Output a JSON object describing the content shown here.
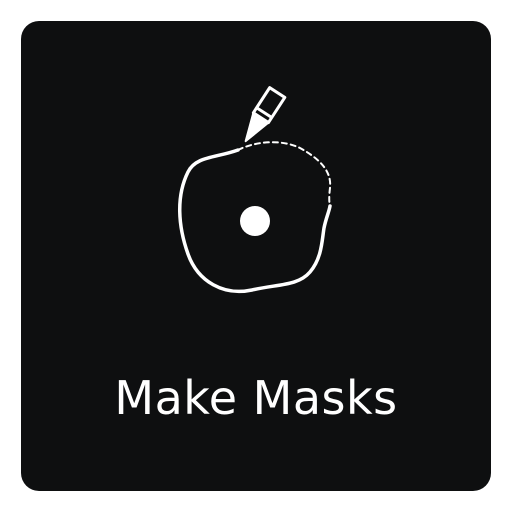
{
  "tile": {
    "label": "Make Masks",
    "icon": "pen-drawing-mask-outline-icon",
    "background_color": "#0e0f10",
    "foreground_color": "#ffffff"
  }
}
